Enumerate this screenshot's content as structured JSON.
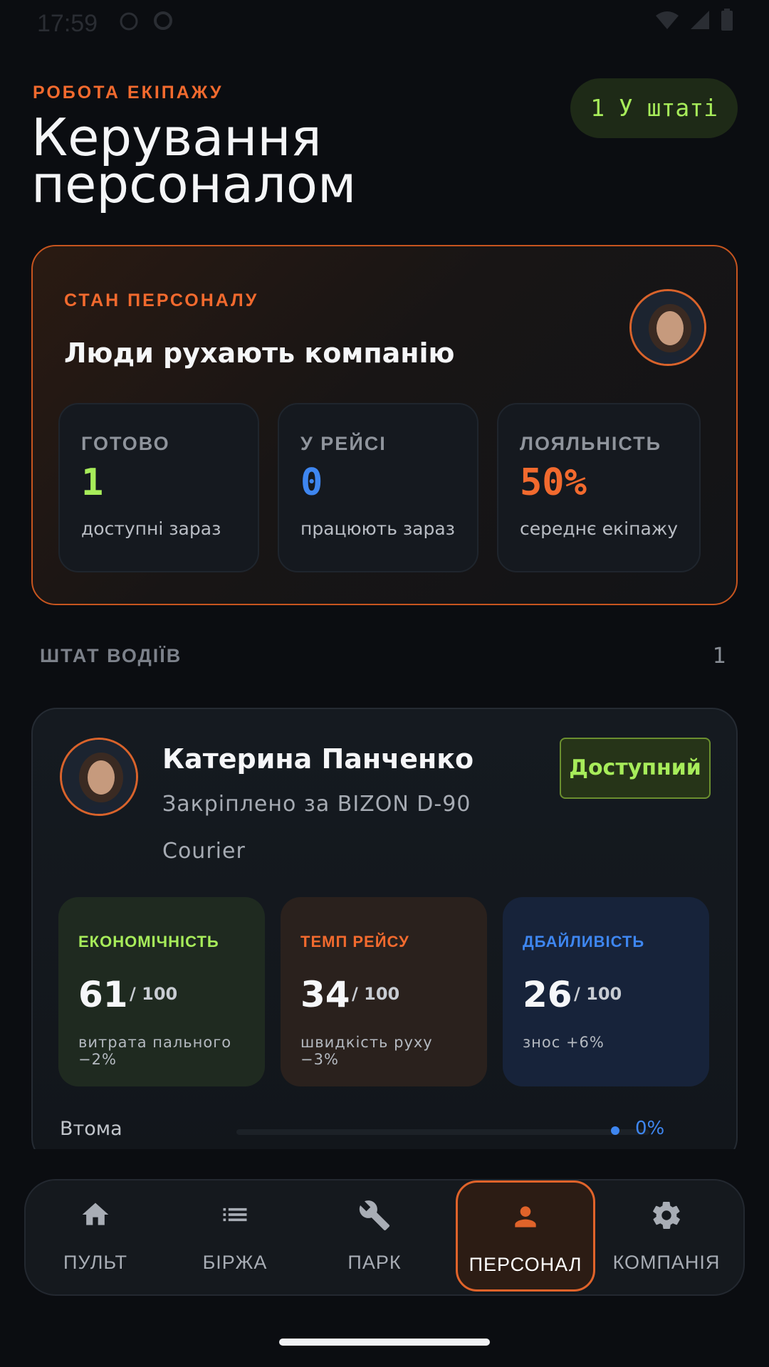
{
  "status_bar": {
    "time": "17:59"
  },
  "header": {
    "eyebrow": "РОБОТА ЕКІПАЖУ",
    "title": "Керування персоналом",
    "staff_pill": "1 У штаті"
  },
  "state_card": {
    "eyebrow": "СТАН ПЕРСОНАЛУ",
    "heading": "Люди рухають компанію",
    "stats": [
      {
        "label": "ГОТОВО",
        "value": "1",
        "caption": "доступні зараз",
        "color": "#a7ec5a"
      },
      {
        "label": "У РЕЙСІ",
        "value": "0",
        "caption": "працюють зараз",
        "color": "#3e86f0"
      },
      {
        "label": "ЛОЯЛЬНІСТЬ",
        "value": "50%",
        "caption": "середнє екіпажу",
        "color": "#f26a2e"
      }
    ]
  },
  "section": {
    "title": "ШТАТ ВОДІЇВ",
    "count": "1"
  },
  "driver": {
    "name": "Катерина Панченко",
    "assignment": "Закріплено за BIZON D-90",
    "role": "Courier",
    "status": "Доступний",
    "metrics": [
      {
        "label": "ЕКОНОМІЧНІСТЬ",
        "value": "61",
        "max": "/ 100",
        "caption": "витрата пального −2%",
        "color": "#a7ec5a",
        "bg": "#1f2a20"
      },
      {
        "label": "ТЕМП РЕЙСУ",
        "value": "34",
        "max": "/ 100",
        "caption": "швидкість руху −3%",
        "color": "#f26a2e",
        "bg": "#2a211d"
      },
      {
        "label": "ДБАЙЛИВІСТЬ",
        "value": "26",
        "max": "/ 100",
        "caption": "знос +6%",
        "color": "#3e86f0",
        "bg": "#17233a"
      }
    ],
    "fatigue": {
      "label": "Втома",
      "value": "0%",
      "fraction": 0
    }
  },
  "nav": {
    "items": [
      {
        "label": "ПУЛЬТ",
        "icon": "home-icon"
      },
      {
        "label": "БІРЖА",
        "icon": "list-icon"
      },
      {
        "label": "ПАРК",
        "icon": "wrench-icon"
      },
      {
        "label": "ПЕРСОНАЛ",
        "icon": "person-icon",
        "active": true
      },
      {
        "label": "КОМПАНІЯ",
        "icon": "gear-icon"
      }
    ],
    "accent": "#e0632a"
  }
}
